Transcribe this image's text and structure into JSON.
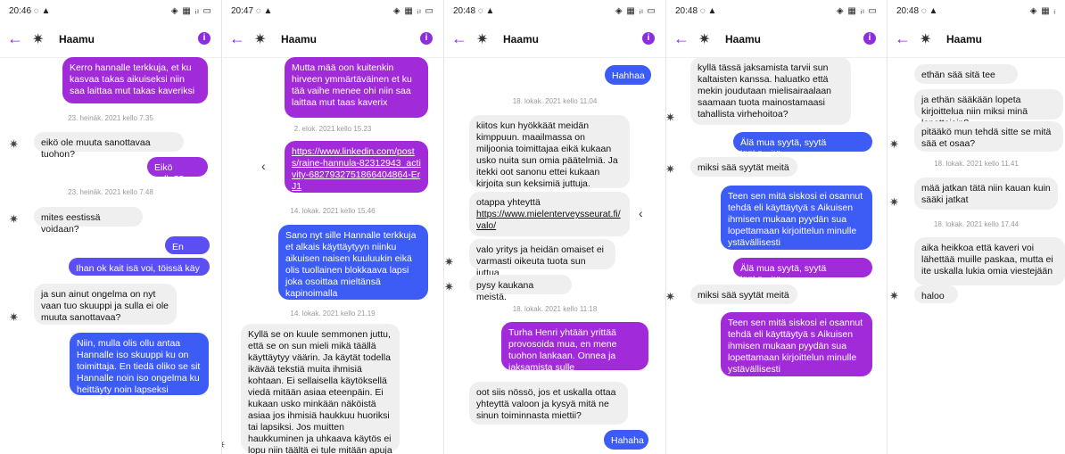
{
  "panels": [
    {
      "status_time": "20:46",
      "status_icons": "◈ ▦ ᵢₗ ▭",
      "header": {
        "back": "←",
        "name": "Haamu",
        "info": "i"
      },
      "items": [
        {
          "kind": "sent",
          "text": "Kerro hannalle terkkuja, et ku kasvaa takas aikuiseksi niin saa laittaa mut takas kaveriksi",
          "grad": "a"
        },
        {
          "kind": "ts",
          "text": "23. heinäk. 2021 kello 7.35"
        },
        {
          "kind": "recv",
          "text": "eikö ole muuta sanottavaa tuohon?",
          "avatar": true
        },
        {
          "kind": "sent",
          "text": "Eikö sulla??",
          "grad": "b"
        },
        {
          "kind": "ts",
          "text": "23. heinäk. 2021 kello 7.48"
        },
        {
          "kind": "recv",
          "text": "mites eestissä voidaan?",
          "avatar": true
        },
        {
          "kind": "sent",
          "text": "En tiedä",
          "grad": "c"
        },
        {
          "kind": "sent",
          "text": "Ihan ok kait isä voi, töissä käy jne",
          "grad": "c"
        },
        {
          "kind": "recv",
          "text": "ja sun ainut ongelma on nyt vaan tuo skuuppi ja sulla ei ole muuta sanottavaa?",
          "avatar": true
        },
        {
          "kind": "sent",
          "text": "Niin, mulla olis ollu antaa Hannalle iso skuuppi ku on toimittaja. En tiedä oliko se sit Hannalle noin iso ongelma ku heittäyty noin lapseksi",
          "grad": "d"
        }
      ]
    },
    {
      "status_time": "20:47",
      "status_icons": "◈ ▦ ᵢₗ ▭",
      "header": {
        "back": "←",
        "name": "Haamu",
        "info": "i"
      },
      "items": [
        {
          "kind": "sent",
          "text": "Mutta mää oon kuitenkin hirveen ymmärtäväinen et ku tää vaihe menee ohi niin saa laittaa mut taas kaverix",
          "grad": "a"
        },
        {
          "kind": "ts",
          "text": "2. elok. 2021 kello 15.23"
        },
        {
          "kind": "sent",
          "text": "https://www.linkedin.com/posts/raine-hannula-82312943_activity-6827932751866404864-ErJ1",
          "grad": "a",
          "link": true,
          "share": true
        },
        {
          "kind": "ts",
          "text": "14. lokak. 2021 kello 15.46"
        },
        {
          "kind": "sent",
          "text": "Sano nyt sille Hannalle terkkuja et alkais käyttäytyyn niinku aikuisen naisen kuuluukin eikä olis tuollainen blokkaava lapsi joka osoittaa mieltänsä kapinoimalla",
          "grad": "d"
        },
        {
          "kind": "ts",
          "text": "14. lokak. 2021 kello 21.19"
        },
        {
          "kind": "recv",
          "text": "Kyllä se on kuule semmonen juttu, että se on sun mieli mikä täällä käyttäytyy väärin. Ja käytät todella ikävää tekstiä muita ihmisiä kohtaan. Ei sellaisella käytöksellä viedä mitään asiaa eteenpäin. Ei kukaan usko minkään näköistä asiaa jos ihmisiä haukkuu huoriksi tai lapsiksi. Jos muitten haukkuminen ja uhkaava käytös ei lopu niin täältä ei tule mitään apuja eikä sympatiaa onko selvä?",
          "avatar": true
        }
      ]
    },
    {
      "status_time": "20:48",
      "status_icons": "◈ ▦ ᵢₗ ▭",
      "header": {
        "back": "←",
        "name": "Haamu",
        "info": "i"
      },
      "items": [
        {
          "kind": "sent",
          "text": "Hahhaa",
          "grad": "d"
        },
        {
          "kind": "ts",
          "text": "18. lokak. 2021 kello 11.04"
        },
        {
          "kind": "recv",
          "text": "kiitos kun hyökkäät meidän kimppuun. maailmassa on miljoonia toimittajaa eikä kukaan usko nuita sun omia päätelmiä. Ja itekki oot sanonu ettei kukaan kirjoita sun keksimiä juttuja."
        },
        {
          "kind": "recv",
          "text": "otappa yhteyttä https://www.mielenterveysseurat.fi/valo/",
          "linkpart": "https://www.mielenterveysseurat.fi/valo/",
          "lead": "otappa yhteyttä",
          "share": true
        },
        {
          "kind": "recv",
          "text": "valo  yritys ja heidän omaiset ei varmasti oikeuta tuota sun juttua",
          "avatar": true
        },
        {
          "kind": "recv",
          "text": "pysy kaukana meistä.",
          "avatar": true
        },
        {
          "kind": "ts",
          "text": "18. lokak. 2021 kello 11.18"
        },
        {
          "kind": "sent",
          "text": "Turha Henri yhtään yrittää provosoida mua, en mene tuohon lankaan. Onnea ja jaksamista sulle",
          "grad": "a"
        },
        {
          "kind": "recv",
          "text": "oot siis nössö, jos et uskalla ottaa yhteyttä valoon ja kysyä mitä ne sinun toiminnasta miettii?"
        },
        {
          "kind": "sent",
          "text": "Hahaha",
          "grad": "d"
        }
      ]
    },
    {
      "status_time": "20:48",
      "status_icons": "◈ ▦ ᵢₗ ▭",
      "header": {
        "back": "←",
        "name": "Haamu",
        "info": "i"
      },
      "items": [
        {
          "kind": "recv",
          "text": "kyllä tässä jaksamista tarvii sun kaltaisten kanssa.  haluatko että mekin joudutaan mielisairaalaan saamaan tuota mainostamaasi tahallista virhehoitoa?",
          "avatar": true
        },
        {
          "kind": "sent",
          "text": "Älä mua syytä, syytä lääkäreitä",
          "grad": "d"
        },
        {
          "kind": "recv",
          "text": "miksi sää syytät meitä",
          "avatar": true
        },
        {
          "kind": "sent",
          "text": "Teen sen mitä siskosi ei osannut tehdä eli käyttäytyä s Aikuisen ihmisen mukaan pyydän sua lopettamaan kirjoittelun minulle ystävällisesti",
          "grad": "d"
        },
        {
          "kind": "sent",
          "text": "Älä mua syytä, syytä lääkäreitä",
          "grad": "a"
        },
        {
          "kind": "recv",
          "text": "miksi sää syytät meitä",
          "avatar": true
        },
        {
          "kind": "sent",
          "text": "Teen sen mitä siskosi ei osannut tehdä eli käyttäytyä s Aikuisen ihmisen mukaan pyydän sua lopettamaan kirjoittelun minulle ystävällisesti",
          "grad": "a"
        }
      ]
    },
    {
      "status_time": "20:48",
      "status_icons": "◈ ▦ ᵢ",
      "header": {
        "back": "←",
        "name": "Haamu",
        "info": ""
      },
      "items": [
        {
          "kind": "recv",
          "text": "ethän sää sitä tee"
        },
        {
          "kind": "recv",
          "text": "ja ethän sääkään lopeta kirjoittelua niin miksi minä lopettaisin?"
        },
        {
          "kind": "recv",
          "text": "pitääkö mun tehdä sitte se mitä sää et osaa?",
          "avatar": true
        },
        {
          "kind": "ts",
          "text": "18. lokak. 2021 kello 11.41"
        },
        {
          "kind": "recv",
          "text": "mää jatkan tätä niin kauan kuin sääki jatkat",
          "avatar": true
        },
        {
          "kind": "ts",
          "text": "18. lokak. 2021 kello 17.44"
        },
        {
          "kind": "recv",
          "text": "aika heikkoa että kaveri voi lähettää muille paskaa, mutta ei ite uskalla lukia omia viestejään"
        },
        {
          "kind": "recv",
          "text": "haloo",
          "avatar": true
        }
      ]
    }
  ],
  "colors": {
    "a": "#a12bd9",
    "b": "#9a30e0",
    "c": "#5b4ef2",
    "d": "#3d5cf5",
    "accent": "#8c2ee0"
  },
  "icons": {
    "avatar": "ghost-avatar",
    "share": "share-icon",
    "back": "back-arrow-icon",
    "info": "info-icon"
  }
}
